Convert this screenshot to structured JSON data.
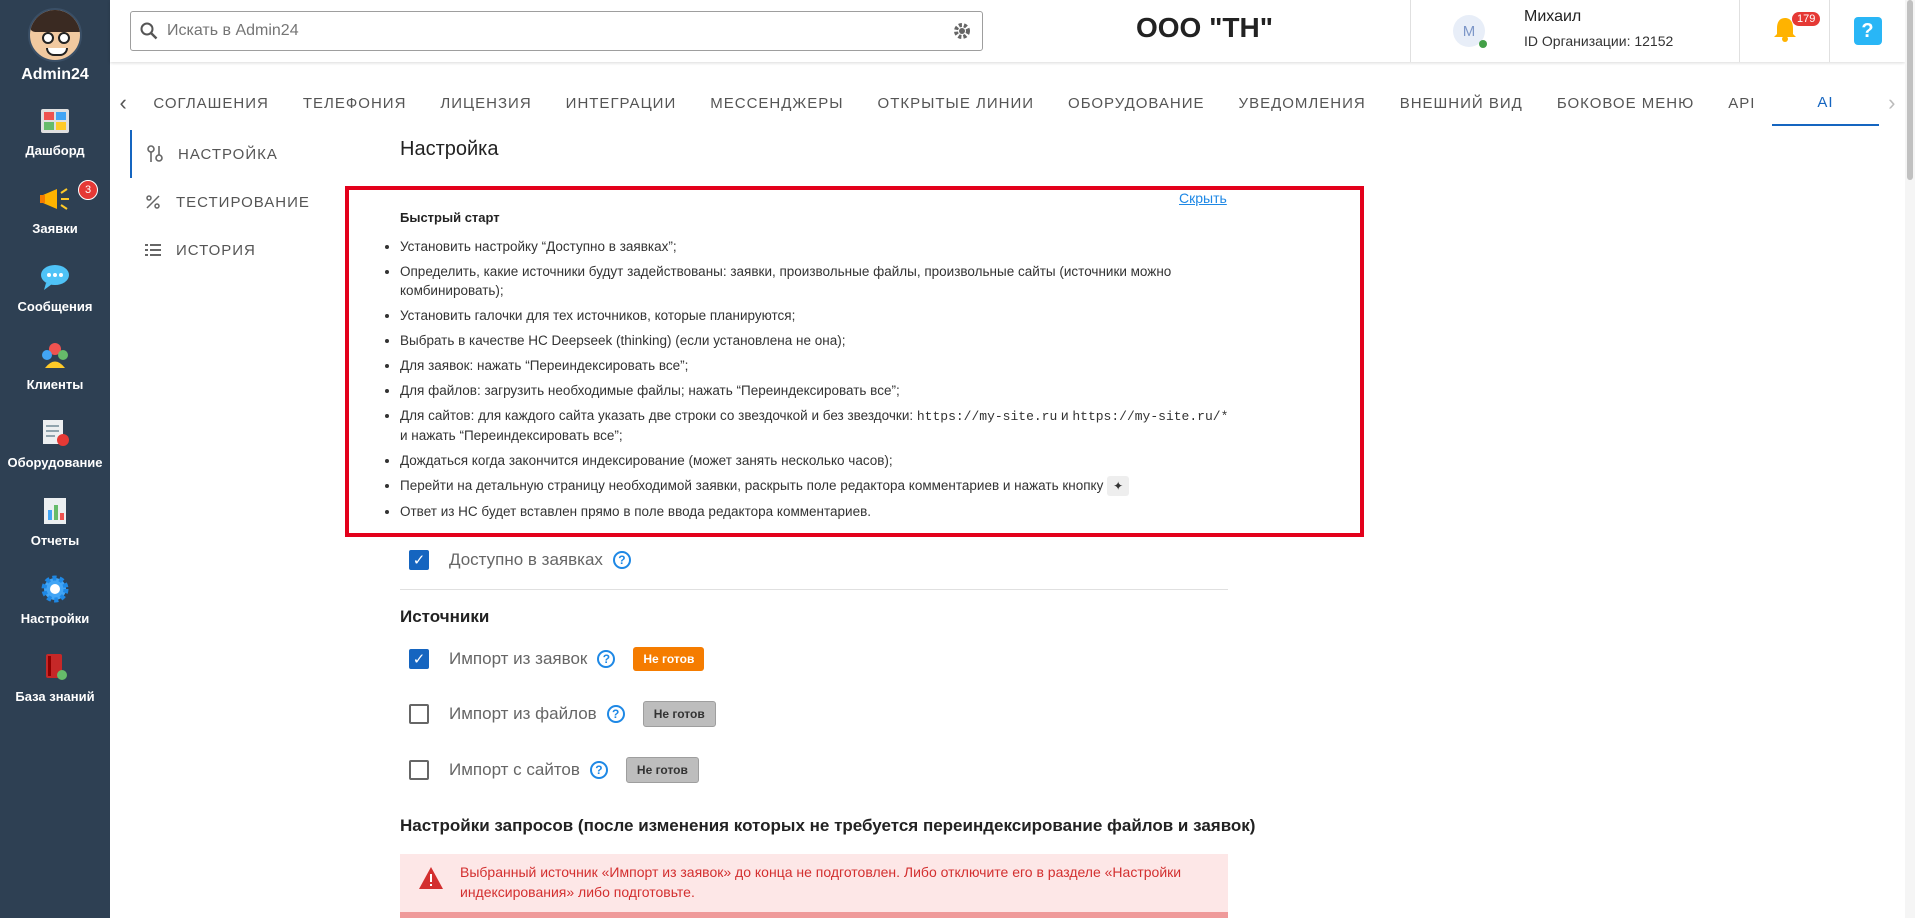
{
  "sidebar": {
    "brand": "Admin24",
    "items": [
      {
        "label": "Дашборд",
        "icon": "dashboard-icon"
      },
      {
        "label": "Заявки",
        "icon": "megaphone-icon",
        "badge": "3"
      },
      {
        "label": "Сообщения",
        "icon": "chat-icon"
      },
      {
        "label": "Клиенты",
        "icon": "clients-icon"
      },
      {
        "label": "Оборудование",
        "icon": "equipment-icon"
      },
      {
        "label": "Отчеты",
        "icon": "reports-icon"
      },
      {
        "label": "Настройки",
        "icon": "gear-icon"
      },
      {
        "label": "База знаний",
        "icon": "book-icon"
      }
    ]
  },
  "header": {
    "search_placeholder": "Искать в Admin24",
    "org_title": "ООО \"ТН\"",
    "user": {
      "initial": "М",
      "name": "Михаил",
      "org_id": "ID Организации: 12152"
    },
    "notifications": "179",
    "help": "?"
  },
  "tabs": [
    "СОГЛАШЕНИЯ",
    "ТЕЛЕФОНИЯ",
    "ЛИЦЕНЗИЯ",
    "ИНТЕГРАЦИИ",
    "МЕССЕНДЖЕРЫ",
    "ОТКРЫТЫЕ ЛИНИИ",
    "ОБОРУДОВАНИЕ",
    "УВЕДОМЛЕНИЯ",
    "ВНЕШНИЙ ВИД",
    "БОКОВОЕ МЕНЮ",
    "API",
    "AI"
  ],
  "subnav": [
    "НАСТРОЙКА",
    "ТЕСТИРОВАНИЕ",
    "ИСТОРИЯ"
  ],
  "main": {
    "title": "Настройка",
    "quickstart": {
      "hide": "Скрыть",
      "title": "Быстрый старт",
      "items": [
        "Установить настройку “Доступно в заявках”;",
        "Определить, какие источники будут задействованы: заявки, произвольные файлы, произвольные сайты (источники можно комбинировать);",
        "Установить галочки для тех источников, которые планируются;",
        "Выбрать в качестве НС Deepseek (thinking) (если установлена не она);",
        "Для заявок: нажать “Переиндексировать все”;",
        "Для файлов: загрузить необходимые файлы; нажать “Переиндексировать все”;"
      ],
      "sites_item": {
        "before": "Для сайтов: для каждого сайта указать две строки со звездочкой и без звездочки: ",
        "url1": "https://my-site.ru",
        "mid": " и ",
        "url2": "https://my-site.ru/*",
        "after": " и нажать “Переиндексировать все”;"
      },
      "items2": [
        "Дождаться когда закончится индексирование (может занять несколько часов);"
      ],
      "detail_item": "Перейти на детальную страницу необходимой заявки, раскрыть поле редактора комментариев и нажать кнопку",
      "last_item": "Ответ из НС будет вставлен прямо в поле ввода редактора комментариев."
    },
    "available": {
      "label": "Доступно в заявках",
      "checked": true
    },
    "sources_title": "Источники",
    "sources": [
      {
        "label": "Импорт из заявок",
        "checked": true,
        "status": "Не готов",
        "status_color": "#f57c00"
      },
      {
        "label": "Импорт из файлов",
        "checked": false,
        "status": "Не готов",
        "status_color": "#bdbdbd"
      },
      {
        "label": "Импорт с сайтов",
        "checked": false,
        "status": "Не готов",
        "status_color": "#bdbdbd"
      }
    ],
    "request_settings_title": "Настройки запросов (после изменения которых не требуется переиндексирование файлов и заявок)",
    "alert": "Выбранный источник «Импорт из заявок» до конца не подготовлен. Либо отключите его в разделе «Настройки индексирования» либо подготовьте."
  },
  "colors": {
    "sidebar": "#2e4053",
    "accent": "#1565c0",
    "highlight_border": "#e3001b",
    "badge": "#e53935"
  }
}
